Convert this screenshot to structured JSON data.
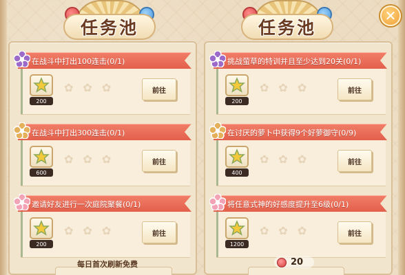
{
  "ui": {
    "close_label": "✕",
    "accent_red": "#e2604b",
    "reward_icon": "star-jade-icon",
    "go_label": "前往"
  },
  "left_panel": {
    "title": "任务池",
    "tasks": [
      {
        "text": "在战斗中打出100连击(0/1)",
        "reward": "200",
        "badge": "purple-flower"
      },
      {
        "text": "在战斗中打出300连击(0/1)",
        "reward": "600",
        "badge": "gold-flower"
      },
      {
        "text": "邀请好友进行一次庭院聚餐(0/1)",
        "reward": "200",
        "badge": "pink-flower"
      }
    ]
  },
  "right_panel": {
    "title": "任务池",
    "tasks": [
      {
        "text": "挑战萤草的特训并且至少达到20关(0/1)",
        "reward": "200",
        "badge": "purple-flower"
      },
      {
        "text": "在讨厌的萝卜中获得9个好萝御守(0/9)",
        "reward": "400",
        "badge": "gold-flower"
      },
      {
        "text": "将任意式神的好感度提升至6级(0/1)",
        "reward": "1200",
        "badge": "pink-flower"
      }
    ]
  },
  "footer": {
    "note": "每日首次刷新免费",
    "cost": "20"
  }
}
